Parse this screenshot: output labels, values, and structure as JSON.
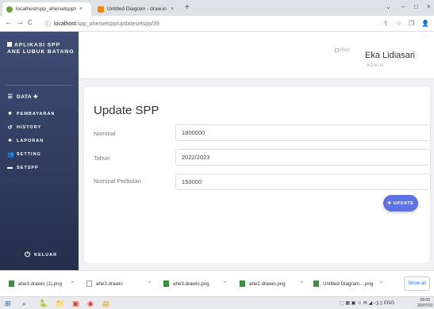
{
  "browser": {
    "tabs": [
      {
        "label": "localhost/spp_ahe/setspp/updat",
        "close": "×",
        "icon_color": "#6ba33a"
      },
      {
        "label": "Untitled Diagram - draw.io",
        "close": "×",
        "icon_color": "#f08705"
      }
    ],
    "new_tab": "+",
    "window_controls": [
      "⌄",
      "–",
      "□",
      "×"
    ],
    "url_host": "localhost",
    "url_path": "/spp_ahe/setspp/updatesetspp/39",
    "nav": {
      "back": "←",
      "forward": "→",
      "reload": "C",
      "info": "ⓘ"
    },
    "addr_icons": [
      "⇪",
      "☆",
      "❐",
      "👤"
    ]
  },
  "sidebar": {
    "brand": "APLIKASI SPP ANE LUBUK BATANG",
    "items": [
      {
        "label": "DATA ✚",
        "icon": "list-icon",
        "glyph": "☰"
      },
      {
        "label": "PEMBAYARAN",
        "icon": "payment-icon",
        "glyph": "■"
      },
      {
        "label": "HISTORY",
        "icon": "history-icon",
        "glyph": "↺"
      },
      {
        "label": "LAPORAN",
        "icon": "report-icon",
        "glyph": "♣"
      },
      {
        "label": "SETTING",
        "icon": "users-icon",
        "glyph": "👥"
      },
      {
        "label": "SETSPP",
        "icon": "card-icon",
        "glyph": "▬"
      }
    ],
    "logout": {
      "label": "KELUAR",
      "icon": "power-icon",
      "glyph": "⏻"
    }
  },
  "header": {
    "avatar_alt": "PNG",
    "user_name": "Eka Lidiasari",
    "user_role": "ADMIN"
  },
  "form": {
    "title": "Update SPP",
    "fields": [
      {
        "label": "Nominal",
        "value": "1800000"
      },
      {
        "label": "Tahun",
        "value": "2022/2023"
      },
      {
        "label": "Nominal Perbulan",
        "value": "150000"
      }
    ],
    "submit": "✚ UPDATE"
  },
  "downloads": {
    "items": [
      {
        "name": "ahe3.drawio (1).png",
        "icon_color": "#3a8f3a"
      },
      {
        "name": "ahe3.drawio",
        "icon_color": "#9aa0a6"
      },
      {
        "name": "ahe3.drawio.png",
        "icon_color": "#3a8f3a"
      },
      {
        "name": "ahe2.drawio.png",
        "icon_color": "#3a8f3a"
      },
      {
        "name": "Untitled Diagram....png",
        "icon_color": "#3a8f3a"
      }
    ],
    "chevron": "^",
    "show_all": "Show all"
  },
  "taskbar": {
    "start": "⊞",
    "search": "⌕",
    "apps": [
      "🐍",
      "📁",
      "▣",
      "◉",
      "▤"
    ],
    "tray": "⬚ ▦ ▣ ☺ ✉ ◢ ◁) ▯ ENG",
    "clock_time": "06:05",
    "clock_date": "20/07/23"
  },
  "colors": {
    "accent": "#5e72e4",
    "sidebar_top": "#3f4d74",
    "sidebar_bottom": "#262f4b"
  }
}
